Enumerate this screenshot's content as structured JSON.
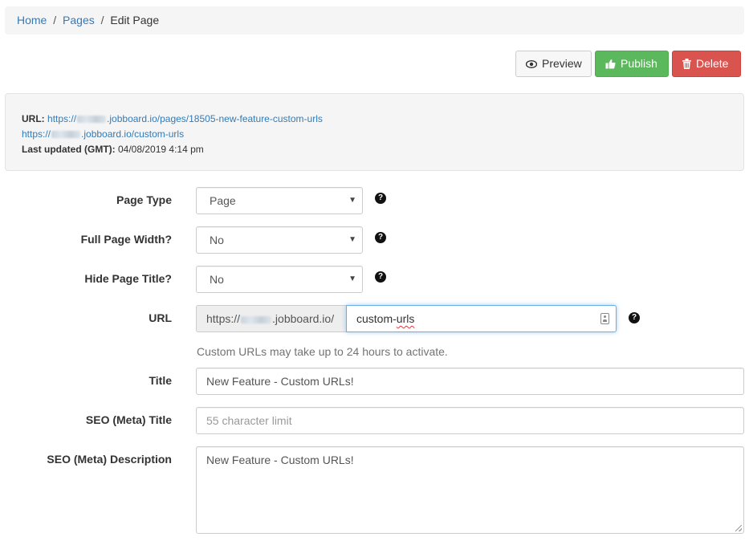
{
  "breadcrumb": {
    "home": "Home",
    "sep1": "/",
    "pages": "Pages",
    "sep2": "/",
    "current": "Edit Page"
  },
  "toolbar": {
    "preview_label": "Preview",
    "publish_label": "Publish",
    "delete_label": "Delete",
    "colors": {
      "publish": "#5cb85c",
      "delete": "#d9534f",
      "preview": "#f7f7f7"
    }
  },
  "info": {
    "url_label": "URL:",
    "url1_prefix": "https://",
    "url1_suffix": ".jobboard.io/pages/18505-new-feature-custom-urls",
    "url2_prefix": "https://",
    "url2_suffix": ".jobboard.io/custom-urls",
    "updated_label": "Last updated (GMT):",
    "updated_value": "04/08/2019 4:14 pm"
  },
  "form": {
    "page_type": {
      "label": "Page Type",
      "value": "Page"
    },
    "full_width": {
      "label": "Full Page Width?",
      "value": "No"
    },
    "hide_title": {
      "label": "Hide Page Title?",
      "value": "No"
    },
    "url": {
      "label": "URL",
      "prefix_start": "https://",
      "prefix_end": ".jobboard.io/",
      "value_plain": "custom-",
      "value_flagged": "urls",
      "help_text": "Custom URLs may take up to 24 hours to activate."
    },
    "title": {
      "label": "Title",
      "value": "New Feature - Custom URLs!"
    },
    "seo_title": {
      "label": "SEO (Meta) Title",
      "placeholder": "55 character limit"
    },
    "seo_description": {
      "label": "SEO (Meta) Description",
      "value": "New Feature - Custom URLs!"
    }
  },
  "icons": {
    "help": "question-circle-icon",
    "caret": "caret-down-icon",
    "preview": "eye-icon",
    "publish": "thumbs-up-icon",
    "delete": "trash-icon"
  }
}
